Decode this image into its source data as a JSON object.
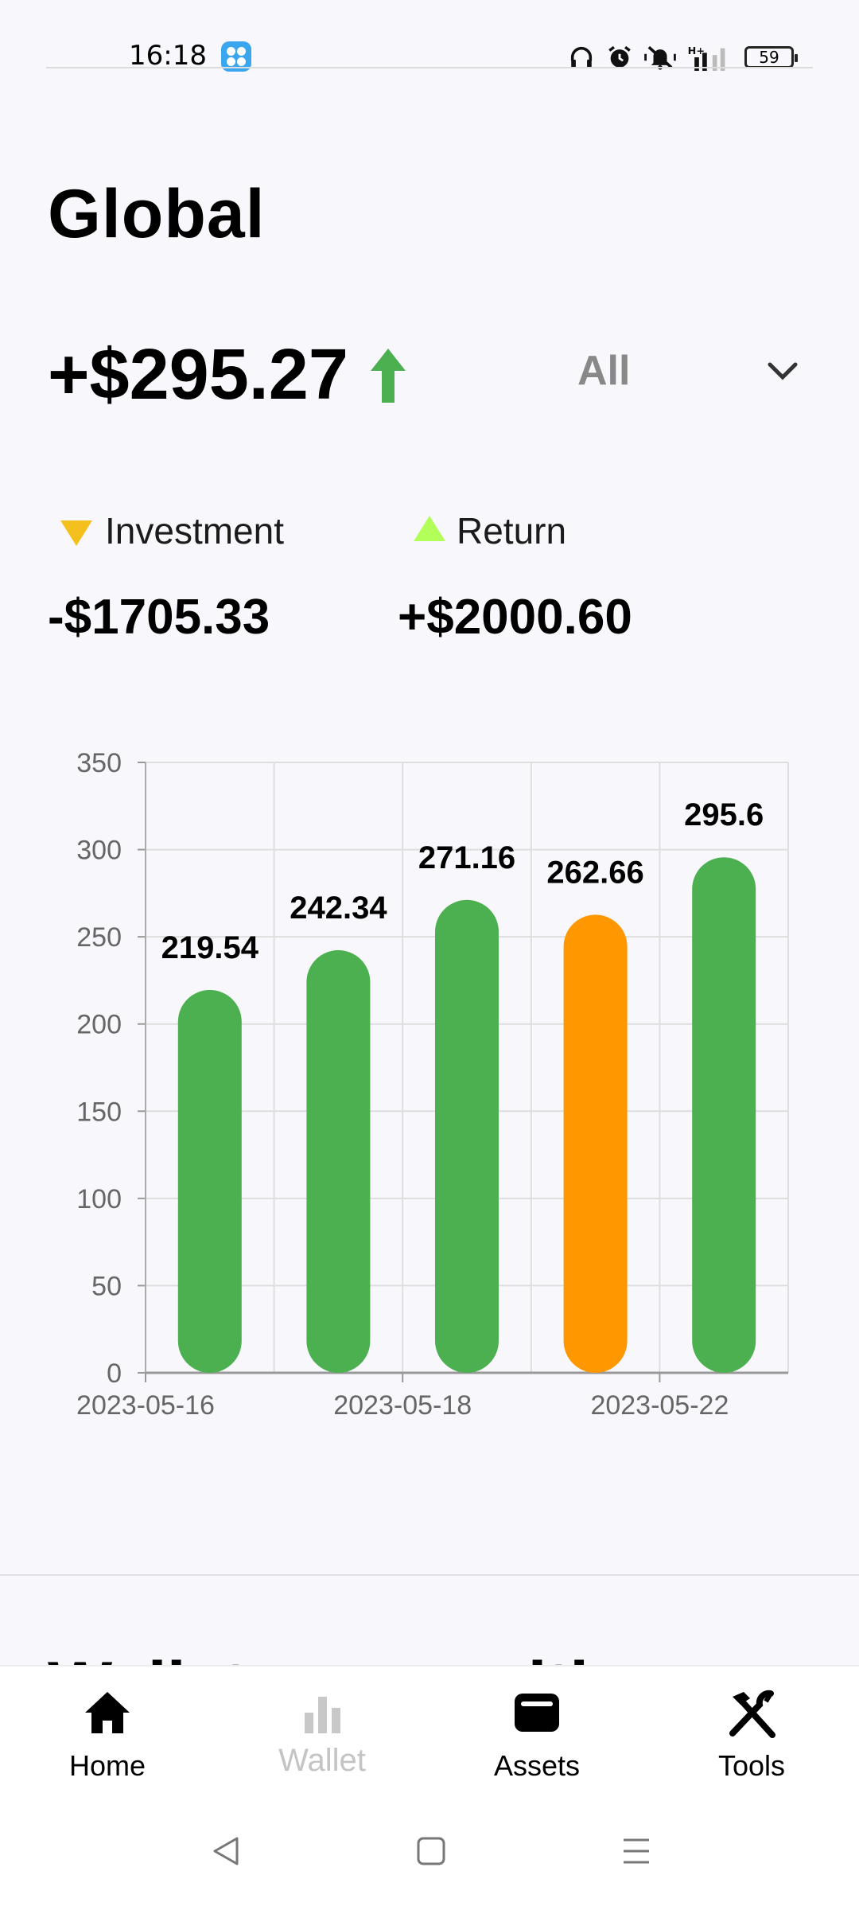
{
  "status_bar": {
    "time": "16:18",
    "battery": "59"
  },
  "header": {
    "title": "Global"
  },
  "summary": {
    "total": "+$295.27",
    "trend": "up",
    "filter": {
      "selected": "All"
    }
  },
  "breakdown": {
    "investment": {
      "label": "Investment",
      "value": "-$1705.33"
    },
    "return": {
      "label": "Return",
      "value": "+$2000.60"
    }
  },
  "colors": {
    "positive": "#4caf50",
    "highlight": "#ff9800",
    "investment_marker": "#f4c01e",
    "return_marker": "#b2ff59"
  },
  "chart_data": {
    "type": "bar",
    "categories": [
      "",
      "2023-05-16",
      "",
      "2023-05-18",
      "",
      "2023-05-22",
      ""
    ],
    "x_tick_labels": [
      "2023-05-16",
      "2023-05-18",
      "2023-05-22"
    ],
    "values": [
      219.54,
      242.34,
      271.16,
      262.66,
      295.6
    ],
    "value_labels": [
      "219.54",
      "242.34",
      "271.16",
      "262.66",
      "295.6"
    ],
    "bar_colors": [
      "#4caf50",
      "#4caf50",
      "#4caf50",
      "#ff9800",
      "#4caf50"
    ],
    "ylim": [
      0,
      350
    ],
    "yticks": [
      0,
      50,
      100,
      150,
      200,
      250,
      300,
      350
    ],
    "grid": true,
    "title": "",
    "xlabel": "",
    "ylabel": ""
  },
  "section": {
    "next_title": "Wallet composition"
  },
  "bottom_nav": {
    "items": [
      {
        "label": "Home",
        "icon": "home-icon",
        "active": true
      },
      {
        "label": "Wallet",
        "icon": "bar-chart-icon",
        "active": false
      },
      {
        "label": "Assets",
        "icon": "wallet-icon",
        "active": true
      },
      {
        "label": "Tools",
        "icon": "tools-icon",
        "active": true
      }
    ]
  }
}
